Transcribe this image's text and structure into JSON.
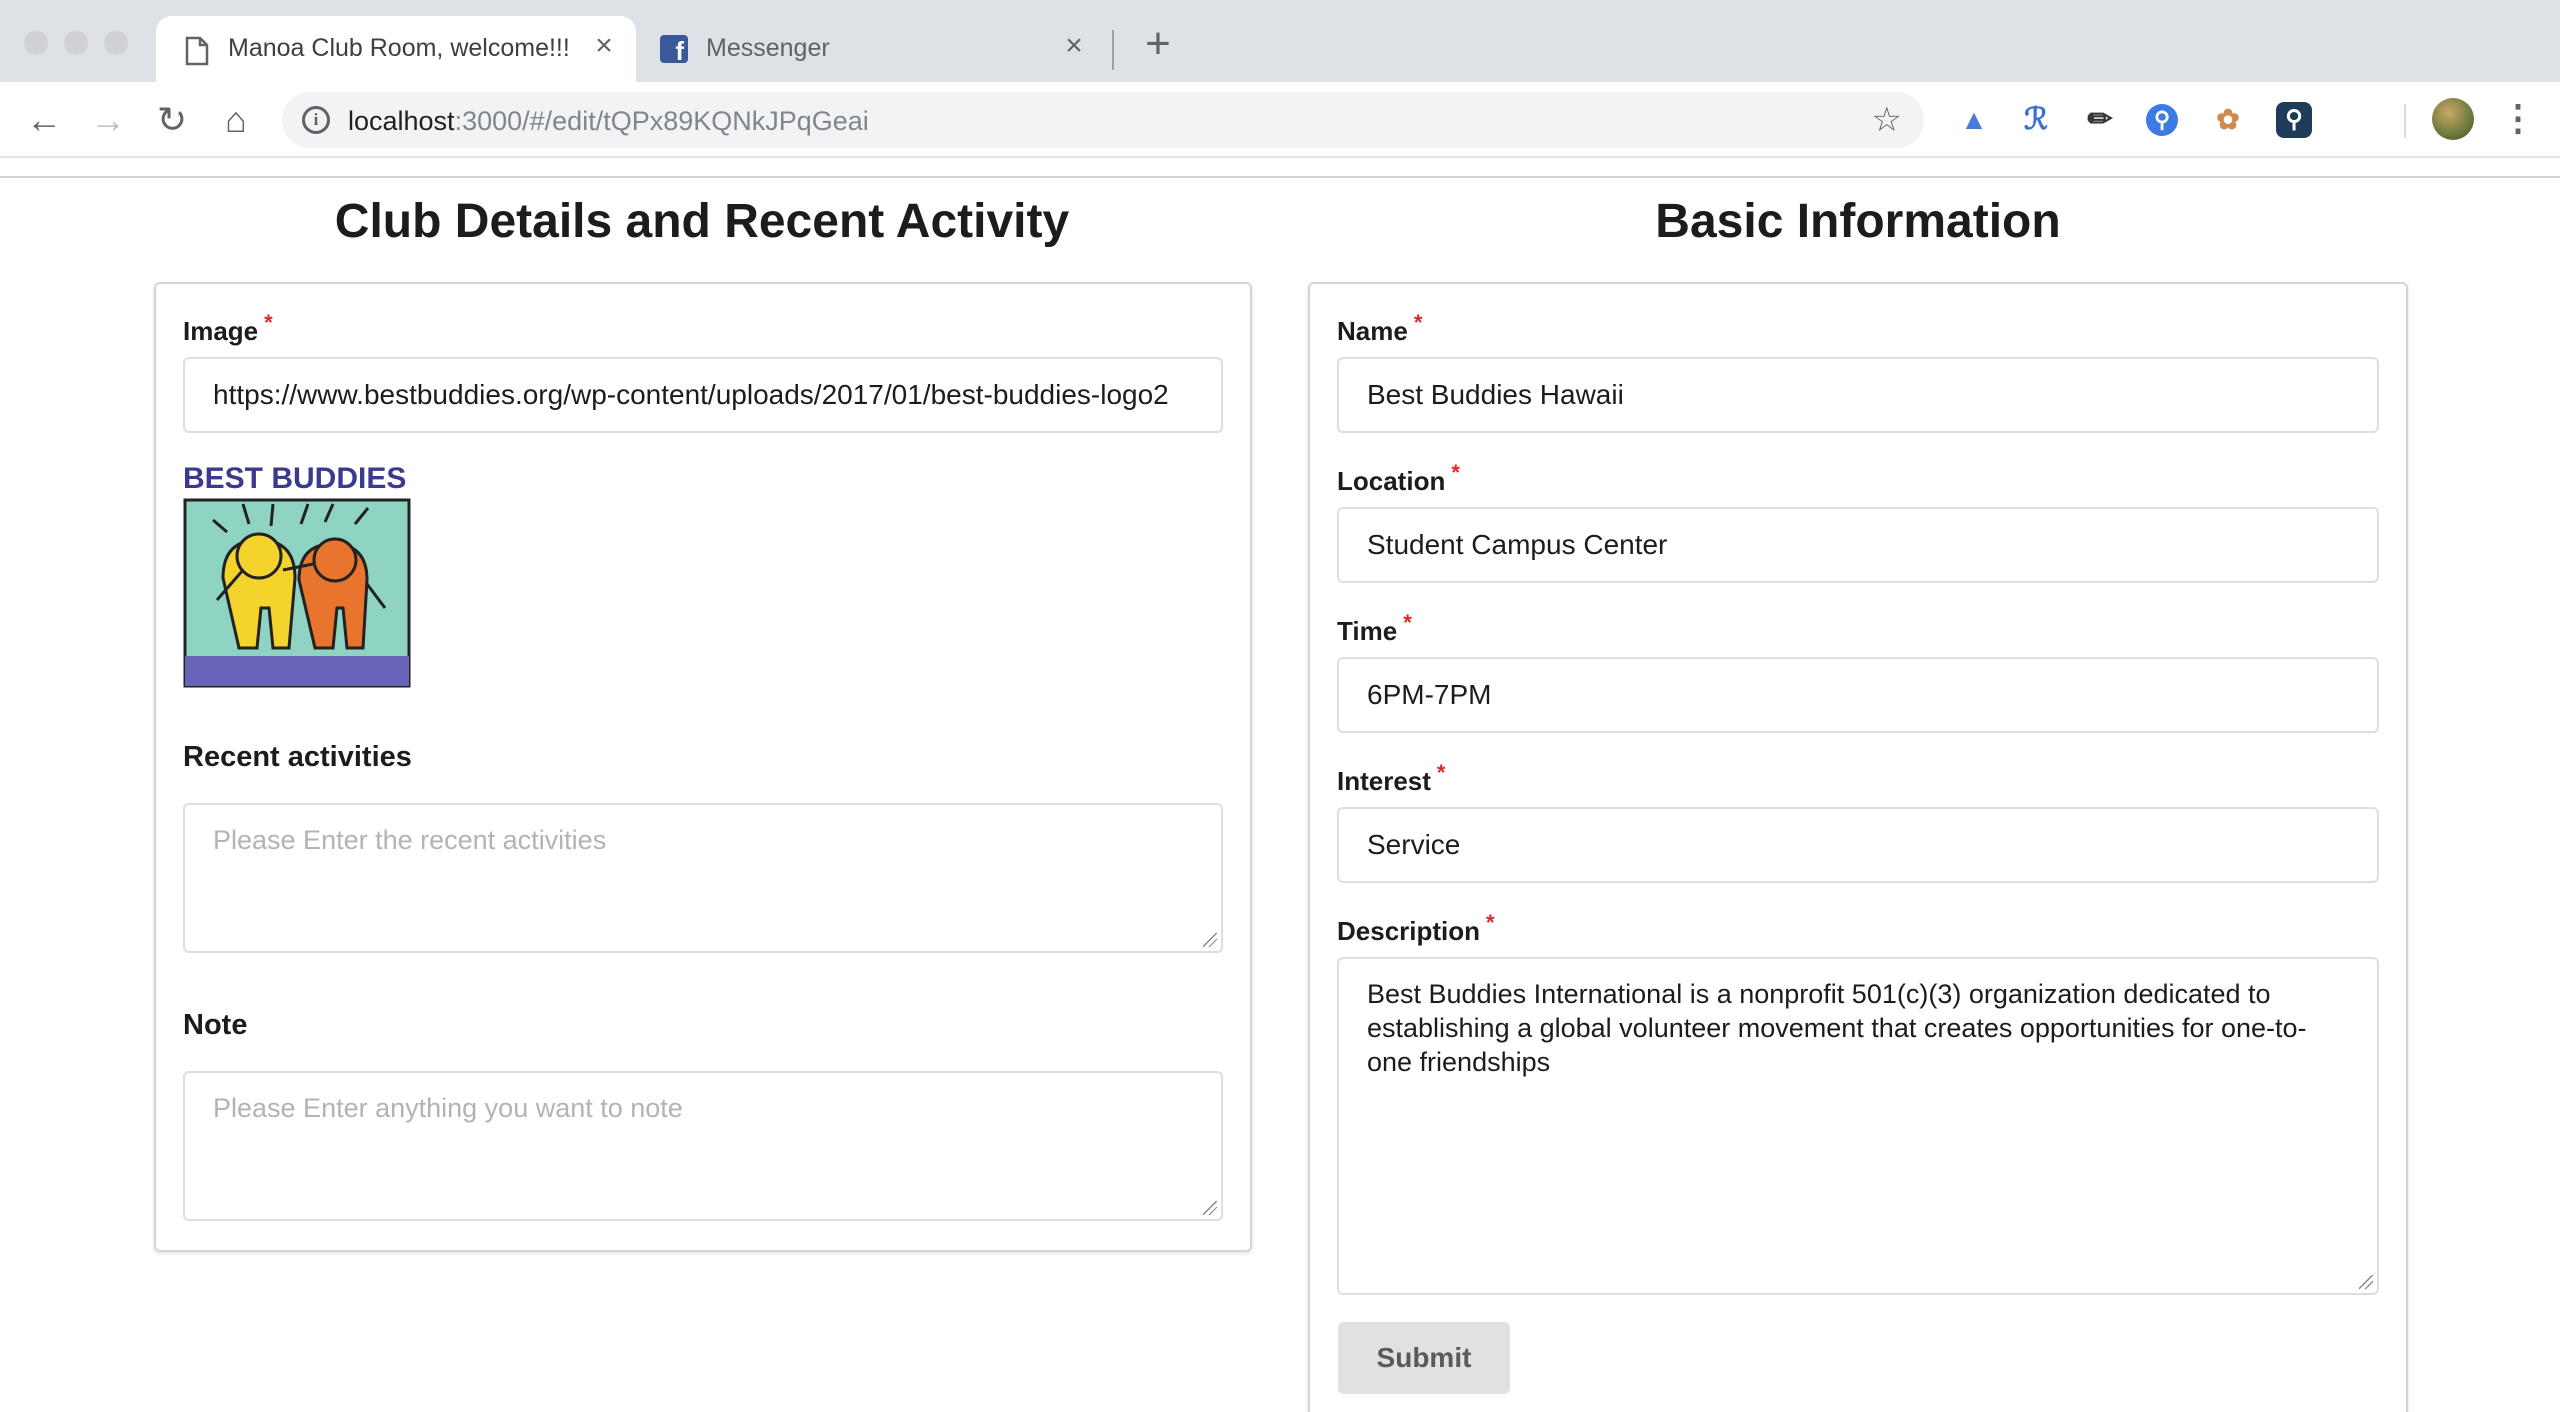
{
  "browser": {
    "tabs": [
      {
        "title": "Manoa Club Room, welcome!!!",
        "icon": "page-icon",
        "active": true
      },
      {
        "title": "Messenger",
        "icon": "facebook-icon",
        "active": false
      }
    ],
    "close_glyph": "×",
    "new_tab_glyph": "+",
    "address": {
      "host": "localhost",
      "path": ":3000/#/edit/tQPx89KQNkJPqGeai"
    },
    "glyphs": {
      "back": "←",
      "forward": "→",
      "reload": "↻",
      "home": "⌂",
      "info": "i",
      "star": "☆",
      "menu": "⋮"
    }
  },
  "left": {
    "title": "Club Details and Recent Activity",
    "image": {
      "label": "Image",
      "required_mark": "*",
      "value": "https://www.bestbuddies.org/wp-content/uploads/2017/01/best-buddies-logo2",
      "logo_text": "BEST BUDDIES"
    },
    "recent": {
      "label": "Recent activities",
      "placeholder": "Please Enter the recent activities"
    },
    "note": {
      "label": "Note",
      "placeholder": "Please Enter anything you want to note"
    }
  },
  "right": {
    "title": "Basic Information",
    "fields": [
      {
        "label": "Name",
        "value": "Best Buddies Hawaii"
      },
      {
        "label": "Location",
        "value": "Student Campus Center"
      },
      {
        "label": "Time",
        "value": "6PM-7PM"
      },
      {
        "label": "Interest",
        "value": "Service"
      }
    ],
    "required_mark": "*",
    "description": {
      "label": "Description",
      "value": "Best Buddies International is a nonprofit 501(c)(3) organization dedicated to establishing a global volunteer movement that creates opportunities for one-to-one friendships"
    },
    "submit_label": "Submit"
  },
  "colors": {
    "required": "#db2828",
    "accent_fb": "#3b5998"
  }
}
